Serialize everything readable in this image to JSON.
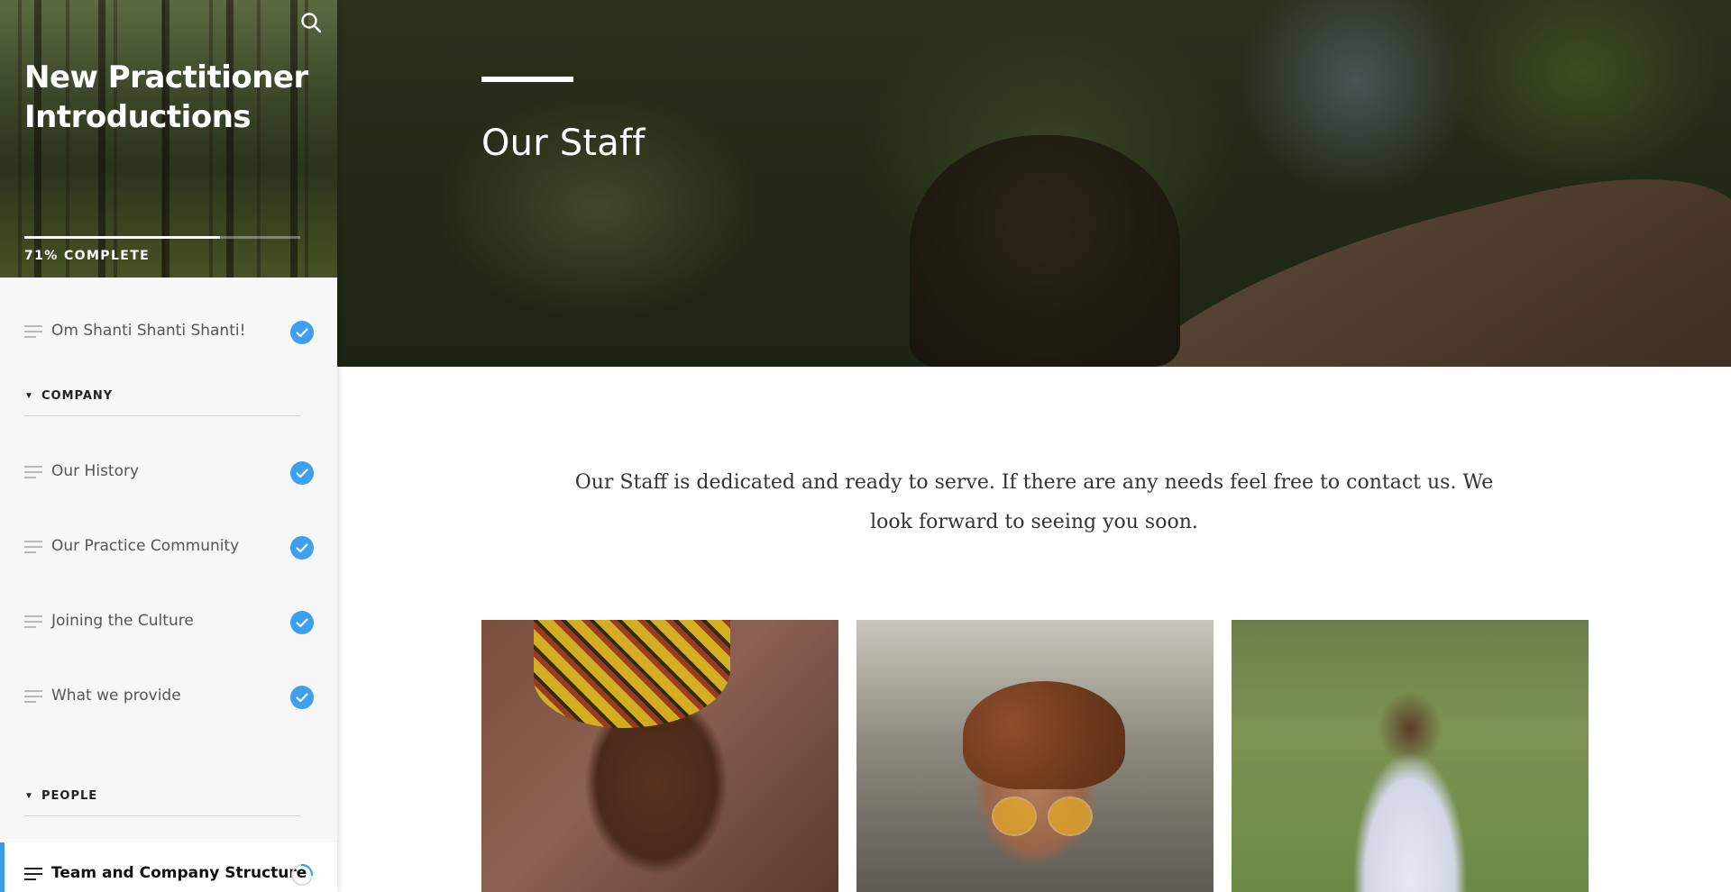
{
  "course": {
    "title": "New Practitioner Introductions",
    "progress_percent": 71,
    "progress_label": "71% COMPLETE"
  },
  "sidebar": {
    "lessons_top": [
      {
        "label": "Om Shanti Shanti Shanti!",
        "status": "complete"
      }
    ],
    "sections": [
      {
        "label": "COMPANY",
        "lessons": [
          {
            "label": "Our History",
            "status": "complete"
          },
          {
            "label": "Our Practice Community",
            "status": "complete"
          },
          {
            "label": "Joining the Culture",
            "status": "complete"
          },
          {
            "label": "What we provide",
            "status": "complete"
          }
        ]
      },
      {
        "label": "PEOPLE",
        "lessons": [
          {
            "label": "Team and Company Structure",
            "status": "in-progress"
          }
        ]
      }
    ]
  },
  "hero": {
    "title": "Our Staff"
  },
  "intro_text": "Our Staff is dedicated and ready to serve. If there are any needs feel free to contact us. We look forward to seeing you soon.",
  "staff_images": [
    {
      "name": "staff-photo-woman-headwrap"
    },
    {
      "name": "staff-photo-man-glasses"
    },
    {
      "name": "staff-photo-man-meditating"
    }
  ],
  "colors": {
    "accent": "#3a9be8",
    "check": "#3d9ff0",
    "sidebar_bg": "#f7f7f7",
    "text_dark": "#222222",
    "text_muted": "#555555"
  },
  "icons": {
    "search": "search-icon",
    "lesson": "lines-icon",
    "complete": "check-circle-icon",
    "in_progress": "spinner-icon",
    "section_toggle": "caret-down-icon"
  }
}
